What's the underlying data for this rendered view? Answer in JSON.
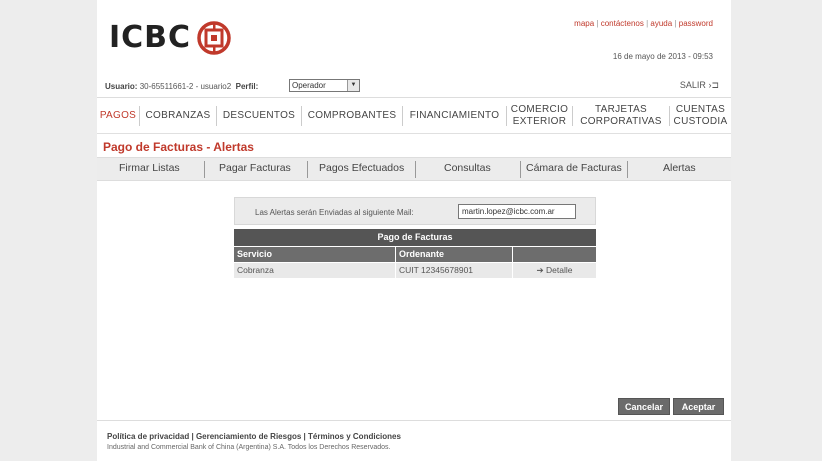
{
  "brand": {
    "name": "ICBC",
    "accent": "#c0392b"
  },
  "top_links": [
    "mapa",
    "contáctenos",
    "ayuda",
    "password"
  ],
  "date": "16 de mayo de 2013 - 09:53",
  "userbar": {
    "user_label": "Usuario:",
    "user_value": "30-65511661-2 - usuario2",
    "profile_label": "Perfil:",
    "profile_value": "Operador",
    "logout": "SALIR"
  },
  "main_nav": [
    {
      "label": "PAGOS",
      "active": true
    },
    {
      "label": "COBRANZAS"
    },
    {
      "label": "DESCUENTOS"
    },
    {
      "label": "COMPROBANTES"
    },
    {
      "label": "FINANCIAMIENTO"
    },
    {
      "label_line1": "COMERCIO",
      "label_line2": "EXTERIOR"
    },
    {
      "label_line1": "TARJETAS",
      "label_line2": "CORPORATIVAS"
    },
    {
      "label_line1": "CUENTAS",
      "label_line2": "CUSTODIA"
    }
  ],
  "section_title": "Pago de Facturas - Alertas",
  "sub_nav": [
    "Firmar Listas",
    "Pagar Facturas",
    "Pagos Efectuados",
    "Consultas",
    "Cámara de Facturas",
    "Alertas"
  ],
  "alert_mail": {
    "label": "Las Alertas serán Enviadas al siguiente Mail:",
    "value": "martin.lopez@icbc.com.ar"
  },
  "table": {
    "caption": "Pago de Facturas",
    "headers": [
      "Servicio",
      "Ordenante",
      ""
    ],
    "rows": [
      {
        "servicio": "Cobranza",
        "ordenante": "CUIT 12345678901",
        "action": "Detalle"
      }
    ]
  },
  "buttons": {
    "cancel": "Cancelar",
    "accept": "Aceptar"
  },
  "footer": {
    "links": [
      "Política de privacidad",
      "Gerenciamiento de Riesgos",
      "Términos y Condiciones"
    ],
    "copyright": "Industrial and Commercial Bank of China (Argentina) S.A. Todos los Derechos Reservados."
  }
}
